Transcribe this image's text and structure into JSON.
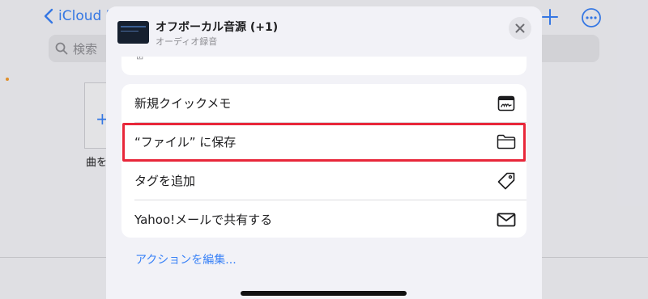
{
  "background": {
    "back_label": "iCloud D",
    "search_placeholder": "検索",
    "tile_label": "曲を",
    "accent_color": "#3a82f7"
  },
  "sheet": {
    "title": "オフボーカル音源 (+1)",
    "subtitle": "オーディオ録音",
    "prev_group_glyph": "⊞",
    "actions": [
      {
        "label": "新規クイックメモ",
        "icon": "quick-note-icon"
      },
      {
        "label": "“ファイル” に保存",
        "icon": "folder-icon",
        "highlighted": true
      },
      {
        "label": "タグを追加",
        "icon": "tag-icon"
      },
      {
        "label": "Yahoo!メールで共有する",
        "icon": "mail-icon"
      }
    ],
    "edit_actions_label": "アクションを編集...",
    "highlight_color": "#e8273a"
  }
}
